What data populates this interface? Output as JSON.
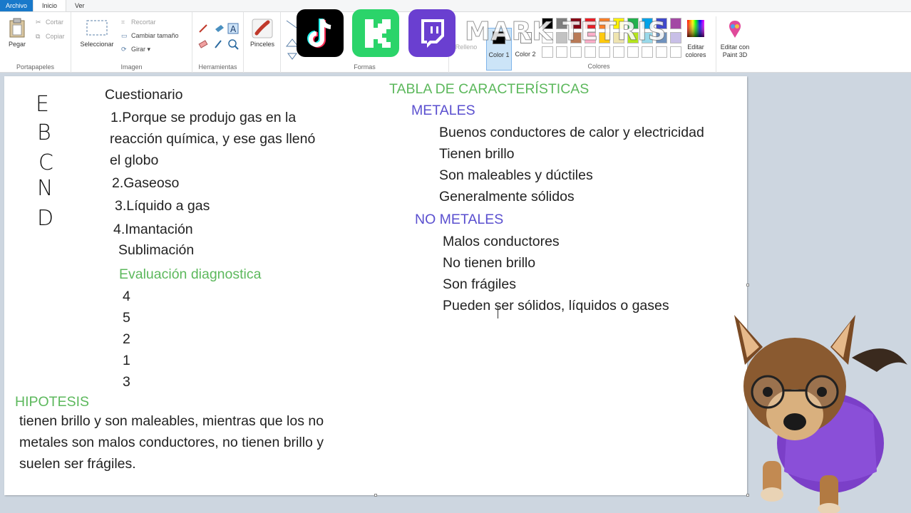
{
  "ribbon": {
    "tabs": [
      "Archivo",
      "Inicio",
      "Ver"
    ],
    "portapapeles": {
      "label": "Portapapeles",
      "paste": "Pegar",
      "cut": "Cortar",
      "copy": "Copiar"
    },
    "imagen": {
      "label": "Imagen",
      "select": "Seleccionar",
      "crop": "Recortar",
      "resize": "Cambiar tamaño",
      "rotate": "Girar"
    },
    "herramientas": {
      "label": "Herramientas"
    },
    "pinceles": {
      "label": "Pinceles"
    },
    "formas": {
      "label": "Formas"
    },
    "colores": {
      "label": "Colores",
      "color1": "Color 1",
      "color2": "Color 2",
      "edit_colors": "Editar colores",
      "edit_paint3d": "Editar con Paint 3D",
      "row1": [
        "#000000",
        "#7f7f7f",
        "#880015",
        "#ed1c24",
        "#ff7f27",
        "#fff200",
        "#22b14c",
        "#00a2e8",
        "#3f48cc",
        "#a349a4"
      ],
      "row2": [
        "#ffffff",
        "#c3c3c3",
        "#b97a57",
        "#ffaec9",
        "#ffc90e",
        "#efe4b0",
        "#b5e61d",
        "#99d9ea",
        "#7092be",
        "#c8bfe7"
      ]
    }
  },
  "overlay": {
    "watermark": "MARK TETRIS",
    "logos": [
      "tiktok-logo",
      "kick-logo",
      "twitch-logo"
    ],
    "logo_colors": {
      "tiktok": "#000000",
      "kick": "#2bd46a",
      "twitch": "#6a3fd0"
    }
  },
  "canvas": {
    "letters": [
      "E",
      "B",
      "C",
      "N",
      "D"
    ],
    "cuestionario": {
      "title": "Cuestionario",
      "q1": [
        "1.Porque se produjo gas en la",
        "reacción química, y ese gas llenó",
        "el globo"
      ],
      "q2": "2.Gaseoso",
      "q3": "3.Líquido a gas",
      "q4": "4.Imantación",
      "q4b": "Sublimación"
    },
    "evaluacion": {
      "title": "Evaluación diagnostica",
      "answers": [
        "4",
        "5",
        "2",
        "1",
        "3"
      ]
    },
    "hipotesis": {
      "title": "HIPOTESIS",
      "lines": [
        "tienen brillo y son maleables, mientras que los no",
        "metales son malos conductores, no tienen brillo y",
        "suelen ser frágiles."
      ]
    },
    "tabla": {
      "title": "TABLA DE CARACTERÍSTICAS",
      "metales_title": "METALES",
      "metales": [
        "Buenos conductores de calor y electricidad",
        "Tienen brillo",
        "Son maleables y dúctiles",
        "Generalmente sólidos"
      ],
      "no_metales_title": "NO METALES",
      "no_metales": [
        "Malos conductores",
        "No tienen brillo",
        "Son frágiles",
        "Pueden ser sólidos, líquidos o gases"
      ]
    }
  },
  "colors": {
    "green": "#5cb85c",
    "purple": "#5a4fcf",
    "accent": "#1979ca"
  }
}
